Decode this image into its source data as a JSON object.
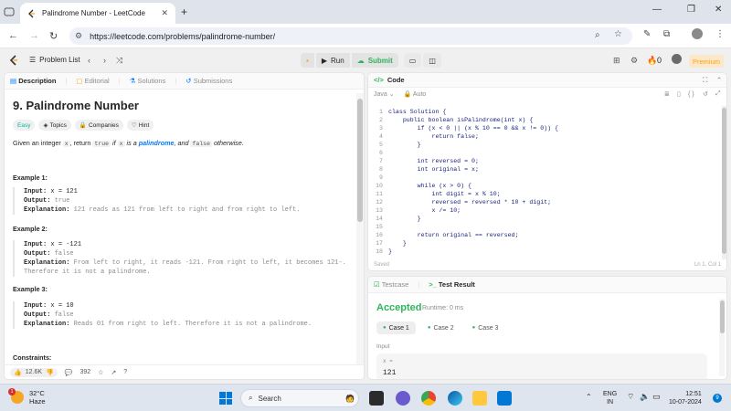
{
  "browser": {
    "tab_title": "Palindrome Number - LeetCode",
    "url": "https://leetcode.com/problems/palindrome-number/"
  },
  "header": {
    "problem_list": "Problem List",
    "run": "Run",
    "submit": "Submit",
    "streak": "0",
    "premium": "Premium"
  },
  "left_tabs": {
    "description": "Description",
    "editorial": "Editorial",
    "solutions": "Solutions",
    "submissions": "Submissions"
  },
  "problem": {
    "title": "9. Palindrome Number",
    "difficulty": "Easy",
    "topics": "Topics",
    "companies": "Companies",
    "hint": "Hint",
    "desc_pre": "Given an integer",
    "desc_x": "x",
    "desc_return": ", return",
    "desc_true": "true",
    "desc_if": "if",
    "desc_x2": "x",
    "desc_isa": "is a",
    "desc_pal": "palindrome",
    "desc_and": ", and",
    "desc_false": "false",
    "desc_otherwise": "otherwise."
  },
  "examples": [
    {
      "title": "Example 1:",
      "input_label": "Input:",
      "input": "x = 121",
      "output_label": "Output:",
      "output": "true",
      "expl_label": "Explanation:",
      "explanation": "121 reads as 121 from left to right and from right to left.",
      "explanation2": ""
    },
    {
      "title": "Example 2:",
      "input_label": "Input:",
      "input": "x = -121",
      "output_label": "Output:",
      "output": "false",
      "expl_label": "Explanation:",
      "explanation": "From left to right, it reads -121. From right to left, it becomes 121-.",
      "explanation2": "Therefore it is not a palindrome."
    },
    {
      "title": "Example 3:",
      "input_label": "Input:",
      "input": "x = 10",
      "output_label": "Output:",
      "output": "false",
      "expl_label": "Explanation:",
      "explanation": "Reads 01 from right to left. Therefore it is not a palindrome.",
      "explanation2": ""
    }
  ],
  "constraints_title": "Constraints:",
  "footer": {
    "likes": "12.6K",
    "comments": "392"
  },
  "code_panel": {
    "title": "Code",
    "language": "Java",
    "auto": "Auto",
    "saved": "Saved",
    "cursor": "Ln 1, Col 1",
    "lines": [
      "class Solution {",
      "    public boolean isPalindrome(int x) {",
      "        if (x < 0 || (x % 10 == 0 && x != 0)) {",
      "            return false;",
      "        }",
      "",
      "        int reversed = 0;",
      "        int original = x;",
      "",
      "        while (x > 0) {",
      "            int digit = x % 10;",
      "            reversed = reversed * 10 + digit;",
      "            x /= 10;",
      "        }",
      "",
      "        return original == reversed;",
      "    }",
      "}"
    ]
  },
  "result_panel": {
    "testcase_tab": "Testcase",
    "result_tab": "Test Result",
    "status": "Accepted",
    "runtime": "Runtime: 0 ms",
    "cases": [
      "Case 1",
      "Case 2",
      "Case 3"
    ],
    "input_label": "Input",
    "var_name": "x =",
    "var_value": "121"
  },
  "taskbar": {
    "temp": "32°C",
    "weather": "Haze",
    "search": "Search",
    "lang1": "ENG",
    "lang2": "IN",
    "time": "12:51",
    "date": "10-07-2024",
    "weather_badge": "1",
    "notif_count": "9"
  },
  "colors": {
    "accent_green": "#2db55d",
    "easy": "#00b8a3",
    "premium": "#ffa116",
    "link_blue": "#007aff"
  }
}
